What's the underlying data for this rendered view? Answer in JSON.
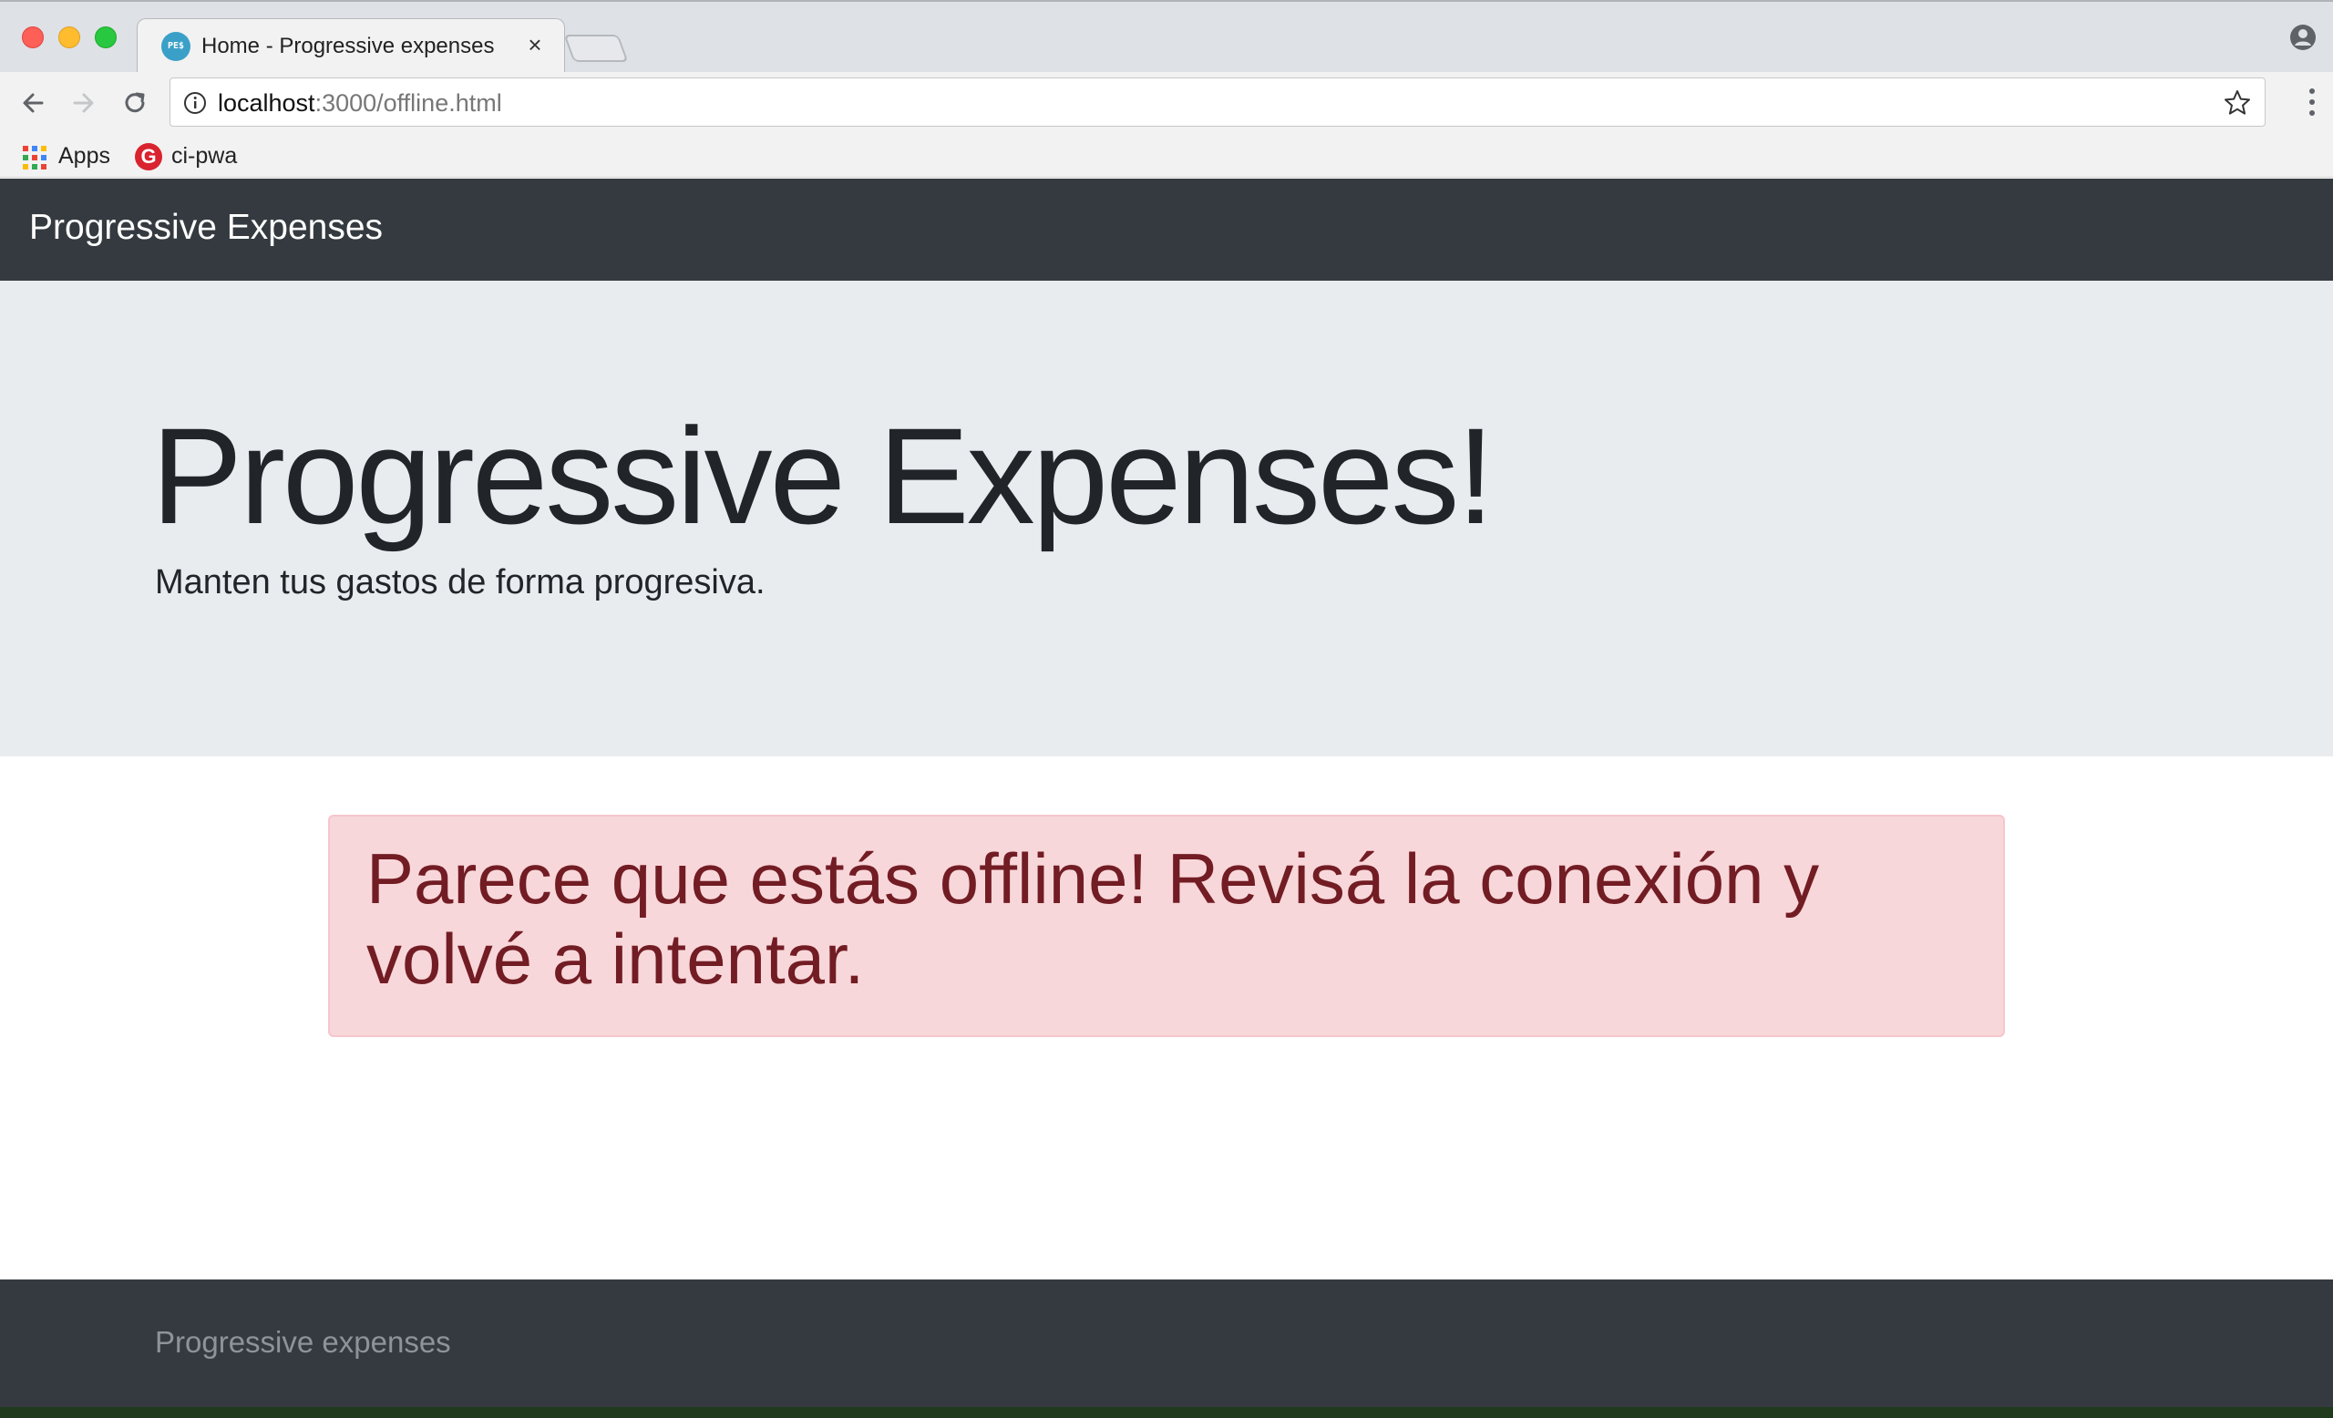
{
  "browser": {
    "tab": {
      "favicon_text": "PE$",
      "title": "Home - Progressive expenses",
      "close_glyph": "×"
    },
    "address_bar": {
      "host": "localhost",
      "path": ":3000/offline.html"
    },
    "bookmarks": [
      {
        "label": "Apps",
        "icon": "apps-grid-icon"
      },
      {
        "label": "ci-pwa",
        "icon": "ci-pwa-icon",
        "icon_glyph": "G"
      }
    ],
    "colors": {
      "tabstrip": "#dee1e6",
      "toolbar": "#f2f2f2"
    }
  },
  "page": {
    "navbar": {
      "brand": "Progressive Expenses"
    },
    "jumbotron": {
      "title": "Progressive Expenses!",
      "lead": "Manten tus gastos de forma progresiva."
    },
    "alert": {
      "message": "Parece que estás offline! Revisá la conexión y volvé a intentar."
    },
    "footer": {
      "text": "Progressive expenses"
    },
    "colors": {
      "navbar_bg": "#343a40",
      "jumbotron_bg": "#e9ecef",
      "alert_bg": "#f8d7da",
      "alert_text": "#721c24"
    }
  }
}
